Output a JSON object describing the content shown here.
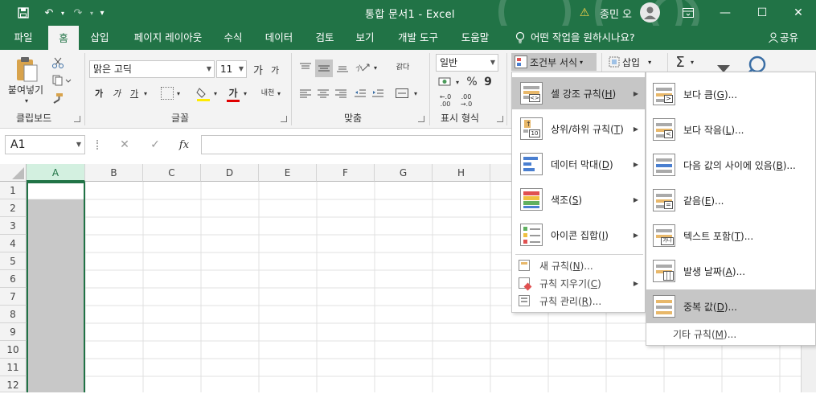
{
  "titlebar": {
    "doc_title": "통합 문서1  -  Excel",
    "user_name": "종민 오",
    "warning_glyph": "⚠",
    "user_glyph": "◯",
    "minimize": "—",
    "maximize": "☐",
    "close": "✕",
    "ribbon_display": "⧉",
    "save_glyph": "💾",
    "undo": "↶",
    "redo": "↷",
    "qat_more": "▾"
  },
  "tabs": [
    "파일",
    "홈",
    "삽입",
    "페이지 레이아웃",
    "수식",
    "데이터",
    "검토",
    "보기",
    "개발 도구",
    "도움말"
  ],
  "tell_me": "어떤 작업을 원하시나요?",
  "tell_me_icon": "lightbulb-icon",
  "share": "공유",
  "ribbon": {
    "clipboard": {
      "paste": "붙여넣기",
      "label": "클립보드"
    },
    "font": {
      "font_name": "맑은 고딕",
      "font_size": "11",
      "grow": "가",
      "shrink": "가",
      "bold": "가",
      "italic": "가",
      "underline": "가",
      "phonetic": "내천",
      "label": "글꼴"
    },
    "align": {
      "wrap": "갉다",
      "label": "맞춤"
    },
    "number": {
      "format": "일반",
      "percent": "%",
      "comma": "9",
      "inc_dec": "←.0 .00",
      "dec_dec": ".00 →.0",
      "label": "표시 형식"
    },
    "styles": {
      "cond_format": "조건부 서식",
      "insert": "삽입",
      "sum": "Σ"
    }
  },
  "formula": {
    "name_box": "A1",
    "cancel": "✕",
    "enter": "✓",
    "fx": "fx"
  },
  "columns": [
    "A",
    "B",
    "C",
    "D",
    "E",
    "F",
    "G",
    "H"
  ],
  "rows": [
    "1",
    "2",
    "3",
    "4",
    "5",
    "6",
    "7",
    "8",
    "9",
    "10",
    "11",
    "12"
  ],
  "menu_main": {
    "items": [
      {
        "label": "셀 강조 규칙(",
        "key": "H",
        "suffix": ")"
      },
      {
        "label": "상위/하위 규칙(",
        "key": "T",
        "suffix": ")"
      },
      {
        "label": "데이터 막대(",
        "key": "D",
        "suffix": ")"
      },
      {
        "label": "색조(",
        "key": "S",
        "suffix": ")"
      },
      {
        "label": "아이콘 집합(",
        "key": "I",
        "suffix": ")"
      }
    ],
    "small": [
      {
        "label": "새 규칙(",
        "key": "N",
        "suffix": ")..."
      },
      {
        "label": "규칙 지우기(",
        "key": "C",
        "suffix": ")"
      },
      {
        "label": "규칙 관리(",
        "key": "R",
        "suffix": ")..."
      }
    ],
    "icon_top_number": "10"
  },
  "menu_sub": {
    "items": [
      {
        "label": "보다 큼(",
        "key": "G",
        "suffix": ")..."
      },
      {
        "label": "보다 작음(",
        "key": "L",
        "suffix": ")..."
      },
      {
        "label": "다음 값의 사이에 있음(",
        "key": "B",
        "suffix": ")..."
      },
      {
        "label": "같음(",
        "key": "E",
        "suffix": ")..."
      },
      {
        "label": "텍스트 포함(",
        "key": "T",
        "suffix": ")..."
      },
      {
        "label": "발생 날짜(",
        "key": "A",
        "suffix": ")..."
      },
      {
        "label": "중복 값(",
        "key": "D",
        "suffix": ")..."
      }
    ],
    "more": {
      "label": "기타 규칙(",
      "key": "M",
      "suffix": ")..."
    },
    "icon_glyphs": [
      ">",
      "<",
      "",
      "=",
      "가나",
      "",
      ""
    ]
  },
  "colors": {
    "accent": "#217346",
    "highlight": "#c6c6c6",
    "selected_col": "#d3f0e0"
  }
}
